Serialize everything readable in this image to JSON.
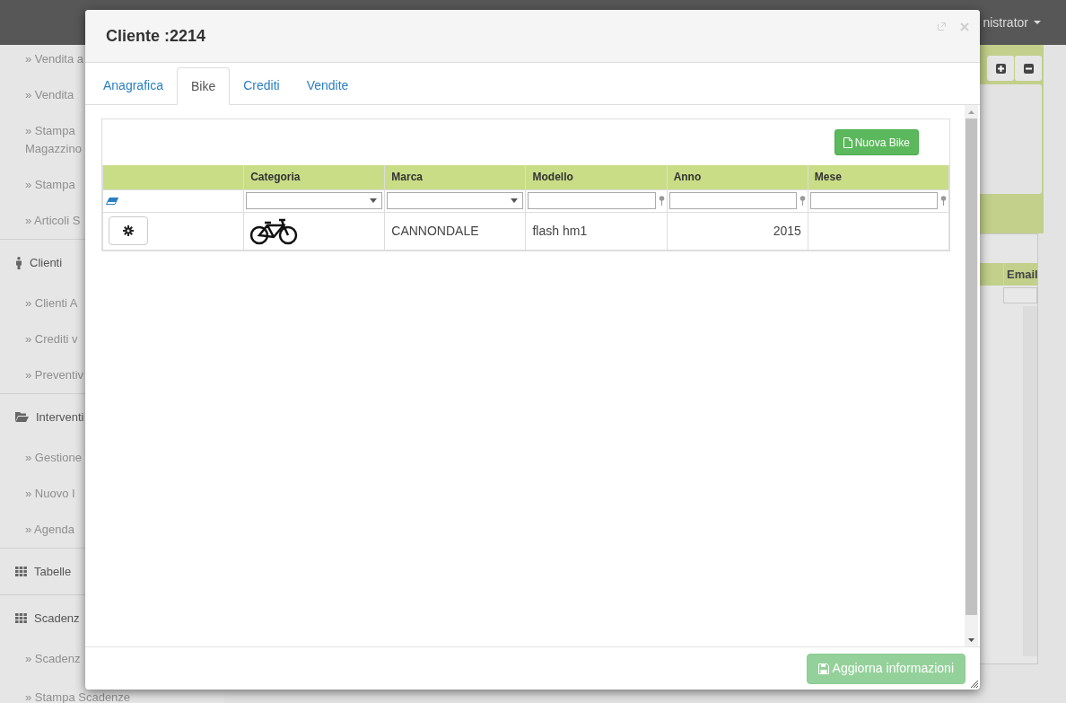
{
  "topbar": {
    "user": "nistrator"
  },
  "sidebar": {
    "items": [
      {
        "kind": "sub",
        "label": "» Vendita a"
      },
      {
        "kind": "sub",
        "label": "» Vendita"
      },
      {
        "kind": "sub",
        "label": "» Stampa",
        "second_line": "Magazzino"
      },
      {
        "kind": "sub",
        "label": "» Stampa"
      },
      {
        "kind": "sub",
        "label": "» Articoli S"
      },
      {
        "kind": "person-section",
        "label": "Clienti"
      },
      {
        "kind": "sub",
        "label": "» Clienti A"
      },
      {
        "kind": "sub",
        "label": "» Crediti v"
      },
      {
        "kind": "sub",
        "label": "» Preventiv"
      },
      {
        "kind": "folder-section",
        "label": "Interventi"
      },
      {
        "kind": "sub",
        "label": "» Gestione"
      },
      {
        "kind": "sub",
        "label": "» Nuovo I"
      },
      {
        "kind": "sub",
        "label": "» Agenda"
      },
      {
        "kind": "grid-section",
        "label": "Tabelle"
      },
      {
        "kind": "grid-section",
        "label": "Scadenz"
      },
      {
        "kind": "sub",
        "label": "» Scadenz"
      },
      {
        "kind": "sub",
        "label": "» Stampa Scadenze"
      }
    ]
  },
  "background_table": {
    "column_label": "Email"
  },
  "modal": {
    "title": "Cliente :2214",
    "tabs": [
      {
        "label": "Anagrafica",
        "selected": false
      },
      {
        "label": "Bike",
        "selected": true
      },
      {
        "label": "Crediti",
        "selected": false
      },
      {
        "label": "Vendite",
        "selected": false
      }
    ],
    "new_button": "Nuova Bike",
    "columns": [
      {
        "kind": "clear"
      },
      {
        "label": "Categoria",
        "kind": "select"
      },
      {
        "label": "Marca",
        "kind": "select"
      },
      {
        "label": "Modello",
        "kind": "text"
      },
      {
        "label": "Anno",
        "kind": "text"
      },
      {
        "label": "Mese",
        "kind": "text"
      }
    ],
    "rows": [
      {
        "marca": "CANNONDALE",
        "modello": "flash hm1",
        "anno": "2015"
      }
    ],
    "save_button": {
      "label": "Aggiorna informazioni",
      "disabled": true
    }
  }
}
